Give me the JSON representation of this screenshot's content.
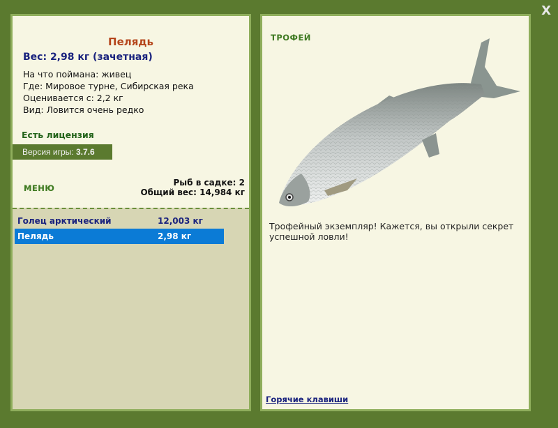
{
  "window": {
    "close_label": "X"
  },
  "fish": {
    "name": "Пелядь",
    "weight": "Вес: 2,98 кг (зачетная)",
    "details": [
      "На что поймана: живец",
      "Где: Мировое турне, Сибирская река",
      "Оценивается с: 2,2 кг",
      "Вид: Ловится очень редко"
    ]
  },
  "license": "Есть лицензия",
  "version": {
    "label": "Версия игры:",
    "value": "3.7.6"
  },
  "menu_label": "МЕНЮ",
  "stats": {
    "count": "Рыб в садке: 2",
    "total": "Общий вес: 14,984 кг"
  },
  "catch_list": [
    {
      "name": "Голец арктический",
      "weight": "12,003 кг",
      "selected": false
    },
    {
      "name": "Пелядь",
      "weight": "2,98 кг",
      "selected": true
    }
  ],
  "trophy_label": "ТРОФЕЙ",
  "description": "Трофейный экземпляр! Кажется, вы открыли секрет успешной ловли!",
  "hotkeys_label": "Горячие клавиши",
  "colors": {
    "background": "#5b7a2f",
    "panel": "#f7f6e3",
    "selected": "#0b7bd6",
    "fish_name": "#b5451b"
  },
  "icons": {
    "fish_picture": "peled-fish-image"
  }
}
